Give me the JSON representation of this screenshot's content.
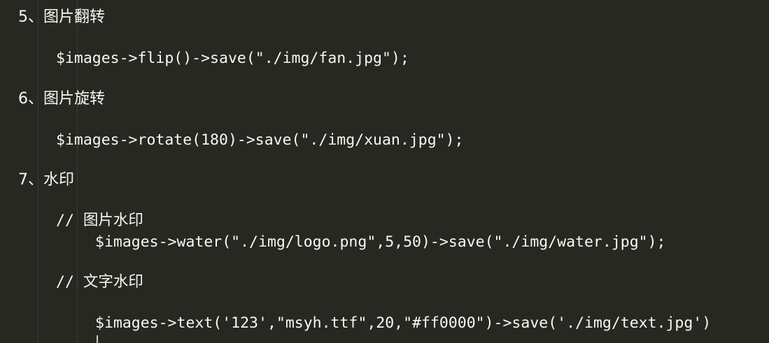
{
  "sections": [
    {
      "heading": "5、图片翻转",
      "code": "$images->flip()->save(\"./img/fan.jpg\");"
    },
    {
      "heading": "6、图片旋转",
      "code": "$images->rotate(180)->save(\"./img/xuan.jpg\");"
    },
    {
      "heading": "7、水印",
      "image_comment": "// 图片水印",
      "image_code": "$images->water(\"./img/logo.png\",5,50)->save(\"./img/water.jpg\");",
      "text_comment": "// 文字水印",
      "text_code": "$images->text('123',\"msyh.ttf\",20,\"#ff0000\")->save('./img/text.jpg')"
    }
  ],
  "colors": {
    "background": "#272822",
    "text": "#f8f8f2",
    "indent_guide": "#3c3d36"
  }
}
